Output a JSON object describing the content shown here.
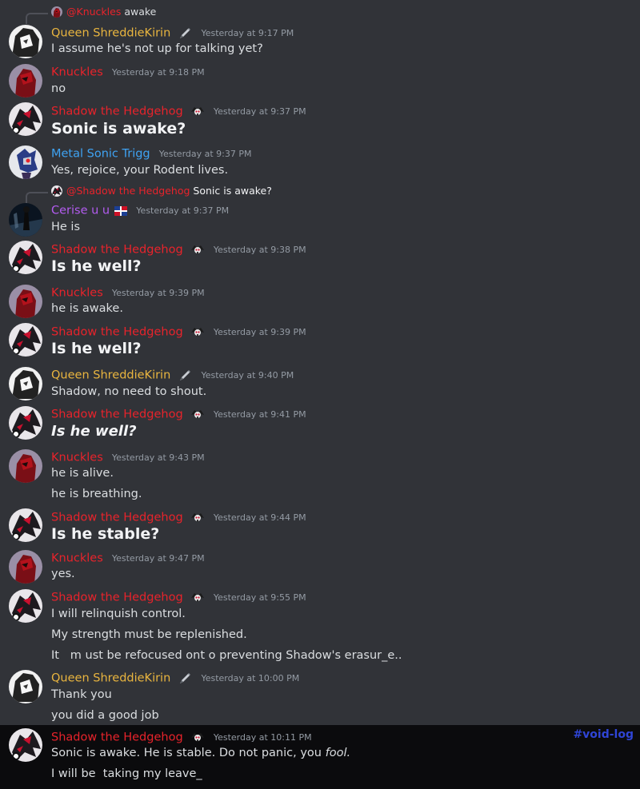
{
  "colors": {
    "background": "#313338",
    "shadow_name": "#e8232b",
    "knuckles_name": "#e8232b",
    "queen_name": "#e9b53f",
    "metal_name": "#3fa3f3",
    "cerise_name": "#b35cf0",
    "timestamp": "#949ba4",
    "void_tag": "#2f45d6"
  },
  "reply1": {
    "mention": "@Knuckles",
    "text": "awake"
  },
  "m1": {
    "user": "Queen ShreddieKirin",
    "badge": "pen-icon",
    "ts": "Yesterday at 9:17 PM",
    "lines": [
      "I assume he's not up for talking yet?"
    ]
  },
  "m2": {
    "user": "Knuckles",
    "ts": "Yesterday at 9:18 PM",
    "lines": [
      "no"
    ]
  },
  "m3": {
    "user": "Shadow the Hedgehog",
    "badge": "skull-icon",
    "ts": "Yesterday at 9:37 PM",
    "lines": [
      "Sonic is awake?"
    ]
  },
  "m4": {
    "user": "Metal Sonic Trigg",
    "ts": "Yesterday at 9:37 PM",
    "lines": [
      "Yes, rejoice, your Rodent lives."
    ]
  },
  "reply2": {
    "mention": "@Shadow the Hedgehog",
    "text": "Sonic is awake?"
  },
  "m5": {
    "user": "Cerise u u",
    "badge": "flag-icon",
    "ts": "Yesterday at 9:37 PM",
    "lines": [
      "He is"
    ]
  },
  "m6": {
    "user": "Shadow the Hedgehog",
    "ts": "Yesterday at 9:38 PM",
    "lines": [
      "Is he well?"
    ]
  },
  "m7": {
    "user": "Knuckles",
    "ts": "Yesterday at 9:39 PM",
    "lines": [
      "he is awake."
    ]
  },
  "m8": {
    "user": "Shadow the Hedgehog",
    "ts": "Yesterday at 9:39 PM",
    "lines": [
      "Is he well?"
    ]
  },
  "m9": {
    "user": "Queen ShreddieKirin",
    "ts": "Yesterday at 9:40 PM",
    "lines": [
      "Shadow, no need to shout."
    ]
  },
  "m10": {
    "user": "Shadow the Hedgehog",
    "ts": "Yesterday at 9:41 PM",
    "lines": [
      "Is he well?"
    ]
  },
  "m11": {
    "user": "Knuckles",
    "ts": "Yesterday at 9:43 PM",
    "lines": [
      "he is alive.",
      "he is breathing."
    ]
  },
  "m12": {
    "user": "Shadow the Hedgehog",
    "ts": "Yesterday at 9:44 PM",
    "lines": [
      "Is he stable?"
    ]
  },
  "m13": {
    "user": "Knuckles",
    "ts": "Yesterday at 9:47 PM",
    "lines": [
      "yes."
    ]
  },
  "m14": {
    "user": "Shadow the Hedgehog",
    "ts": "Yesterday at 9:55 PM",
    "lines": [
      "I will relinquish control.",
      "My strength must be replenished.",
      "It   m ust be refocused ont o preventing Shadow's erasur_e.."
    ]
  },
  "m15": {
    "user": "Queen ShreddieKirin",
    "ts": "Yesterday at 10:00 PM",
    "lines": [
      "Thank you",
      "you did a good job"
    ]
  },
  "m16": {
    "user": "Shadow the Hedgehog",
    "ts": "Yesterday at 10:11 PM",
    "line1_plain": "Sonic is awake. He is stable. Do not panic, you ",
    "line1_italic": "fool.",
    "line2": "I will be  taking my leave_"
  },
  "tag": "#void-log"
}
